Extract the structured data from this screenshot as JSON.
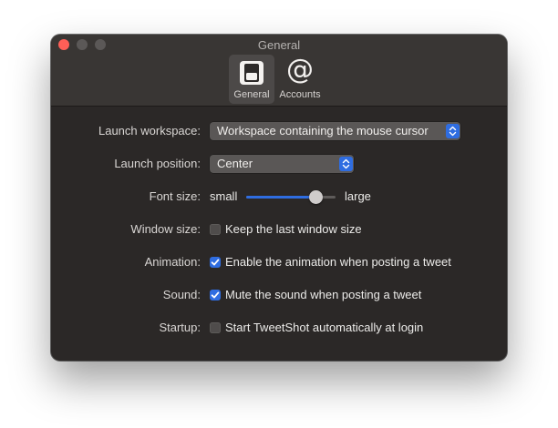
{
  "window": {
    "title": "General"
  },
  "toolbar": {
    "tabs": [
      {
        "label": "General",
        "icon": "general-switch-icon",
        "selected": true
      },
      {
        "label": "Accounts",
        "icon": "at-sign-icon",
        "selected": false
      }
    ]
  },
  "settings": {
    "launch_workspace": {
      "label": "Launch workspace:",
      "value": "Workspace containing the mouse cursor"
    },
    "launch_position": {
      "label": "Launch position:",
      "value": "Center"
    },
    "font_size": {
      "label": "Font size:",
      "min_label": "small",
      "max_label": "large",
      "level": 0.78
    },
    "window_size": {
      "label": "Window size:",
      "option": "Keep the last window size",
      "checked": false
    },
    "animation": {
      "label": "Animation:",
      "option": "Enable the animation when posting a tweet",
      "checked": true
    },
    "sound": {
      "label": "Sound:",
      "option": "Mute the sound when posting a tweet",
      "checked": true
    },
    "startup": {
      "label": "Startup:",
      "option": "Start TweetShot automatically at login",
      "checked": false
    }
  },
  "colors": {
    "accent": "#2f6de1",
    "window_bg": "#2b2827",
    "close_button": "#ff5f57"
  }
}
